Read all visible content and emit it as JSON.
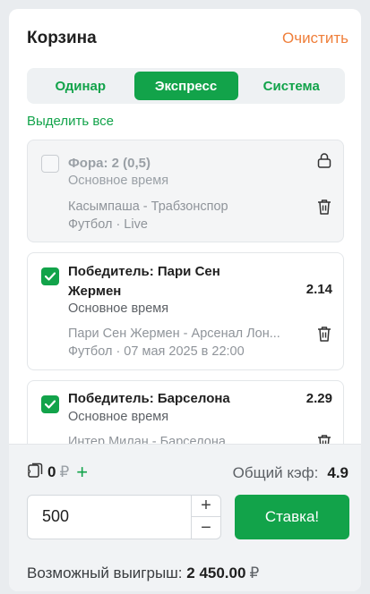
{
  "header": {
    "title": "Корзина",
    "clear_label": "Очистить"
  },
  "tabs": [
    {
      "label": "Одинар",
      "active": false
    },
    {
      "label": "Экспресс",
      "active": true
    },
    {
      "label": "Система",
      "active": false
    }
  ],
  "select_all_label": "Выделить все",
  "bets": [
    {
      "checked": false,
      "locked": true,
      "market": "Фора: 2 (0,5)",
      "period": "Основное время",
      "match": "Касымпаша - Трабзонспор",
      "sport_info": "Футбол · Live",
      "odds": ""
    },
    {
      "checked": true,
      "locked": false,
      "market_line1": "Победитель: Пари Сен",
      "market_line2": "Жермен",
      "period": "Основное время",
      "match": "Пари Сен Жермен - Арсенал Лон...",
      "sport_info": "Футбол · 07 мая 2025 в 22:00",
      "odds": "2.14"
    },
    {
      "checked": true,
      "locked": false,
      "market": "Победитель: Барселона",
      "period": "Основное время",
      "match": "Интер Милан - Барселона",
      "odds": "2.29"
    }
  ],
  "footer": {
    "balance": "0",
    "currency": "₽",
    "add_label": "+",
    "total_coef_label": "Общий кэф:",
    "total_coef_value": "4.9",
    "stake_value": "500",
    "stepper_plus": "+",
    "stepper_minus": "−",
    "bet_button": "Ставка!",
    "possible_win_label": "Возможный выигрыш:",
    "possible_win_value": "2 450.00",
    "possible_win_currency": "₽"
  },
  "colors": {
    "accent": "#12a34a",
    "clear": "#ef7f3b"
  },
  "icons": [
    "lock-icon",
    "trash-icon",
    "checkmark-icon",
    "coupon-icon"
  ]
}
